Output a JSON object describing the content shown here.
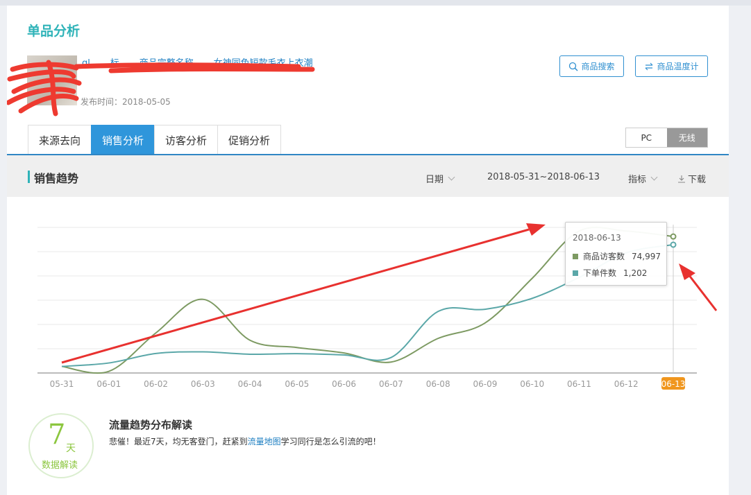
{
  "page": {
    "title": "单品分析"
  },
  "product": {
    "title": "ql...... 标.......商品完整名称.......女神同色短款毛衣上衣潮",
    "publish_label": "发布时间：",
    "publish_date": "2018-05-05"
  },
  "actions": {
    "search_label": "商品搜索",
    "temperature_label": "商品温度计"
  },
  "tabs": [
    {
      "label": "来源去向",
      "active": false
    },
    {
      "label": "销售分析",
      "active": true
    },
    {
      "label": "访客分析",
      "active": false
    },
    {
      "label": "促销分析",
      "active": false
    }
  ],
  "device_switch": {
    "pc": "PC",
    "wireless": "无线",
    "selected": "无线"
  },
  "section": {
    "title": "销售趋势",
    "date_label": "日期",
    "date_range": "2018-05-31~2018-06-13",
    "metric_label": "指标",
    "download_label": "下载"
  },
  "chart_data": {
    "type": "line",
    "categories": [
      "05-31",
      "06-01",
      "06-02",
      "06-03",
      "06-04",
      "06-05",
      "06-06",
      "06-07",
      "06-08",
      "06-09",
      "06-10",
      "06-11",
      "06-12",
      "06-13"
    ],
    "highlighted_category": "06-13",
    "ylim": [
      0,
      80000
    ],
    "grid": true,
    "series": [
      {
        "name": "商品访客数",
        "color": "#7d9a62",
        "values": [
          3600,
          900,
          22000,
          40500,
          18000,
          14000,
          11000,
          6000,
          19000,
          27500,
          52000,
          78000,
          78000,
          74997
        ]
      },
      {
        "name": "下单件数",
        "color": "#5aa7a8",
        "values": [
          3600,
          5500,
          10700,
          11600,
          10300,
          10600,
          9900,
          8500,
          33800,
          35000,
          41000,
          52500,
          66000,
          70500
        ]
      }
    ],
    "tooltip": {
      "date": "2018-06-13",
      "rows": [
        {
          "name": "商品访客数",
          "value": "74,997",
          "color": "#7d9a62"
        },
        {
          "name": "下单件数",
          "value": "1,202",
          "color": "#5aa7a8"
        }
      ]
    }
  },
  "insight": {
    "badge_number": "7",
    "badge_unit": "天",
    "badge_label": "数据解读",
    "title": "流量趋势分布解读",
    "text_before": "悲催！最近7天，均无客登门，赶紧到",
    "link_text": "流量地图",
    "text_after": "学习同行是怎么引流的吧！"
  },
  "colors": {
    "brand": "#2fb3b8",
    "tab_active": "#2f96db",
    "link": "#1e7fc2",
    "highlight": "#f0961e",
    "annotation": "#e8312f"
  }
}
